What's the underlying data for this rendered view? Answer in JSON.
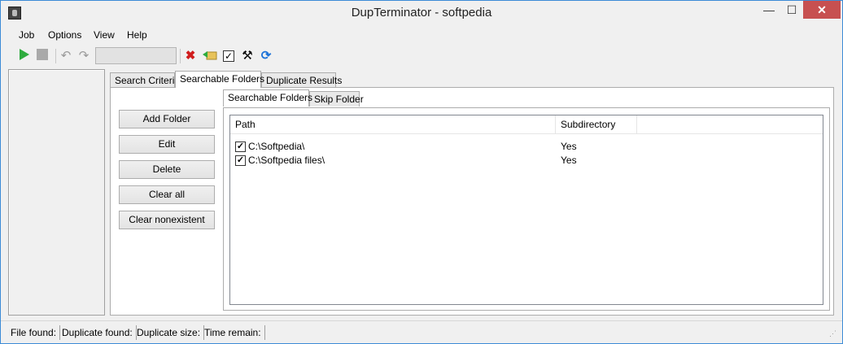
{
  "window": {
    "title": "DupTerminator - softpedia",
    "min_glyph": "—",
    "max_glyph": "☐",
    "close_glyph": "✕"
  },
  "menu": {
    "items": [
      "Job",
      "Options",
      "View",
      "Help"
    ]
  },
  "toolbar": {
    "icons": [
      "play-icon",
      "stop-icon",
      "undo-icon",
      "redo-icon",
      "delete-marked-icon",
      "move-folder-icon",
      "check-all-icon",
      "tools-icon",
      "refresh-icon"
    ],
    "combo_value": ""
  },
  "tabs": [
    "Search Criteria",
    "Searchable Folders",
    "Duplicate Results"
  ],
  "active_tab": "Searchable Folders",
  "buttons": {
    "add": "Add Folder",
    "edit": "Edit",
    "delete": "Delete",
    "clear_all": "Clear all",
    "clear_nonexistent": "Clear nonexistent"
  },
  "inner_tabs": [
    "Searchable Folders",
    "Skip Folder"
  ],
  "list": {
    "columns": [
      "Path",
      "Subdirectory"
    ],
    "rows": [
      {
        "checked": true,
        "path": "C:\\Softpedia\\",
        "subdirectory": "Yes"
      },
      {
        "checked": true,
        "path": "C:\\Softpedia files\\",
        "subdirectory": "Yes"
      }
    ]
  },
  "status": {
    "file_found": "File found:",
    "duplicate_found": "Duplicate found:",
    "duplicate_size": "Duplicate size:",
    "time_remain": "Time remain:"
  },
  "colors": {
    "accent": "#3c8bd6",
    "play": "#2eab3e",
    "close": "#c75050",
    "delete": "#d01c1c",
    "refresh": "#1e73d8"
  }
}
